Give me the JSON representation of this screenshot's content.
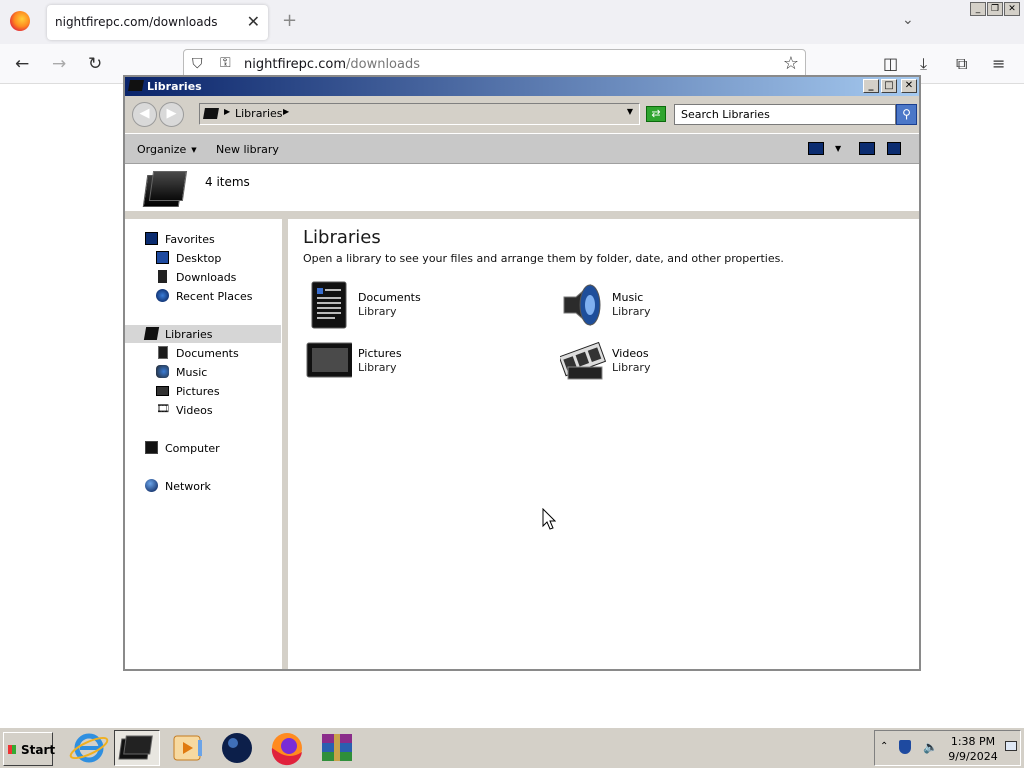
{
  "browser": {
    "tab_title": "nightfirepc.com/downloads",
    "url_host": "nightfirepc.com",
    "url_path": "/downloads"
  },
  "window": {
    "title": "Libraries",
    "breadcrumb": "Libraries",
    "search_placeholder": "Search Libraries"
  },
  "toolbar": {
    "organize": "Organize",
    "new_library": "New library"
  },
  "details": {
    "item_count": "4 items"
  },
  "navpane": {
    "favorites": "Favorites",
    "desktop": "Desktop",
    "downloads": "Downloads",
    "recent_places": "Recent Places",
    "libraries": "Libraries",
    "documents": "Documents",
    "music": "Music",
    "pictures": "Pictures",
    "videos": "Videos",
    "computer": "Computer",
    "network": "Network"
  },
  "content": {
    "title": "Libraries",
    "subtitle": "Open a library to see your files and arrange them by folder, date, and other properties.",
    "libraries": [
      {
        "name": "Documents",
        "type": "Library",
        "icon": "documents-icon"
      },
      {
        "name": "Music",
        "type": "Library",
        "icon": "music-icon"
      },
      {
        "name": "Pictures",
        "type": "Library",
        "icon": "pictures-icon"
      },
      {
        "name": "Videos",
        "type": "Library",
        "icon": "videos-icon"
      }
    ]
  },
  "taskbar": {
    "start": "Start",
    "time": "1:38 PM",
    "date": "9/9/2024"
  }
}
